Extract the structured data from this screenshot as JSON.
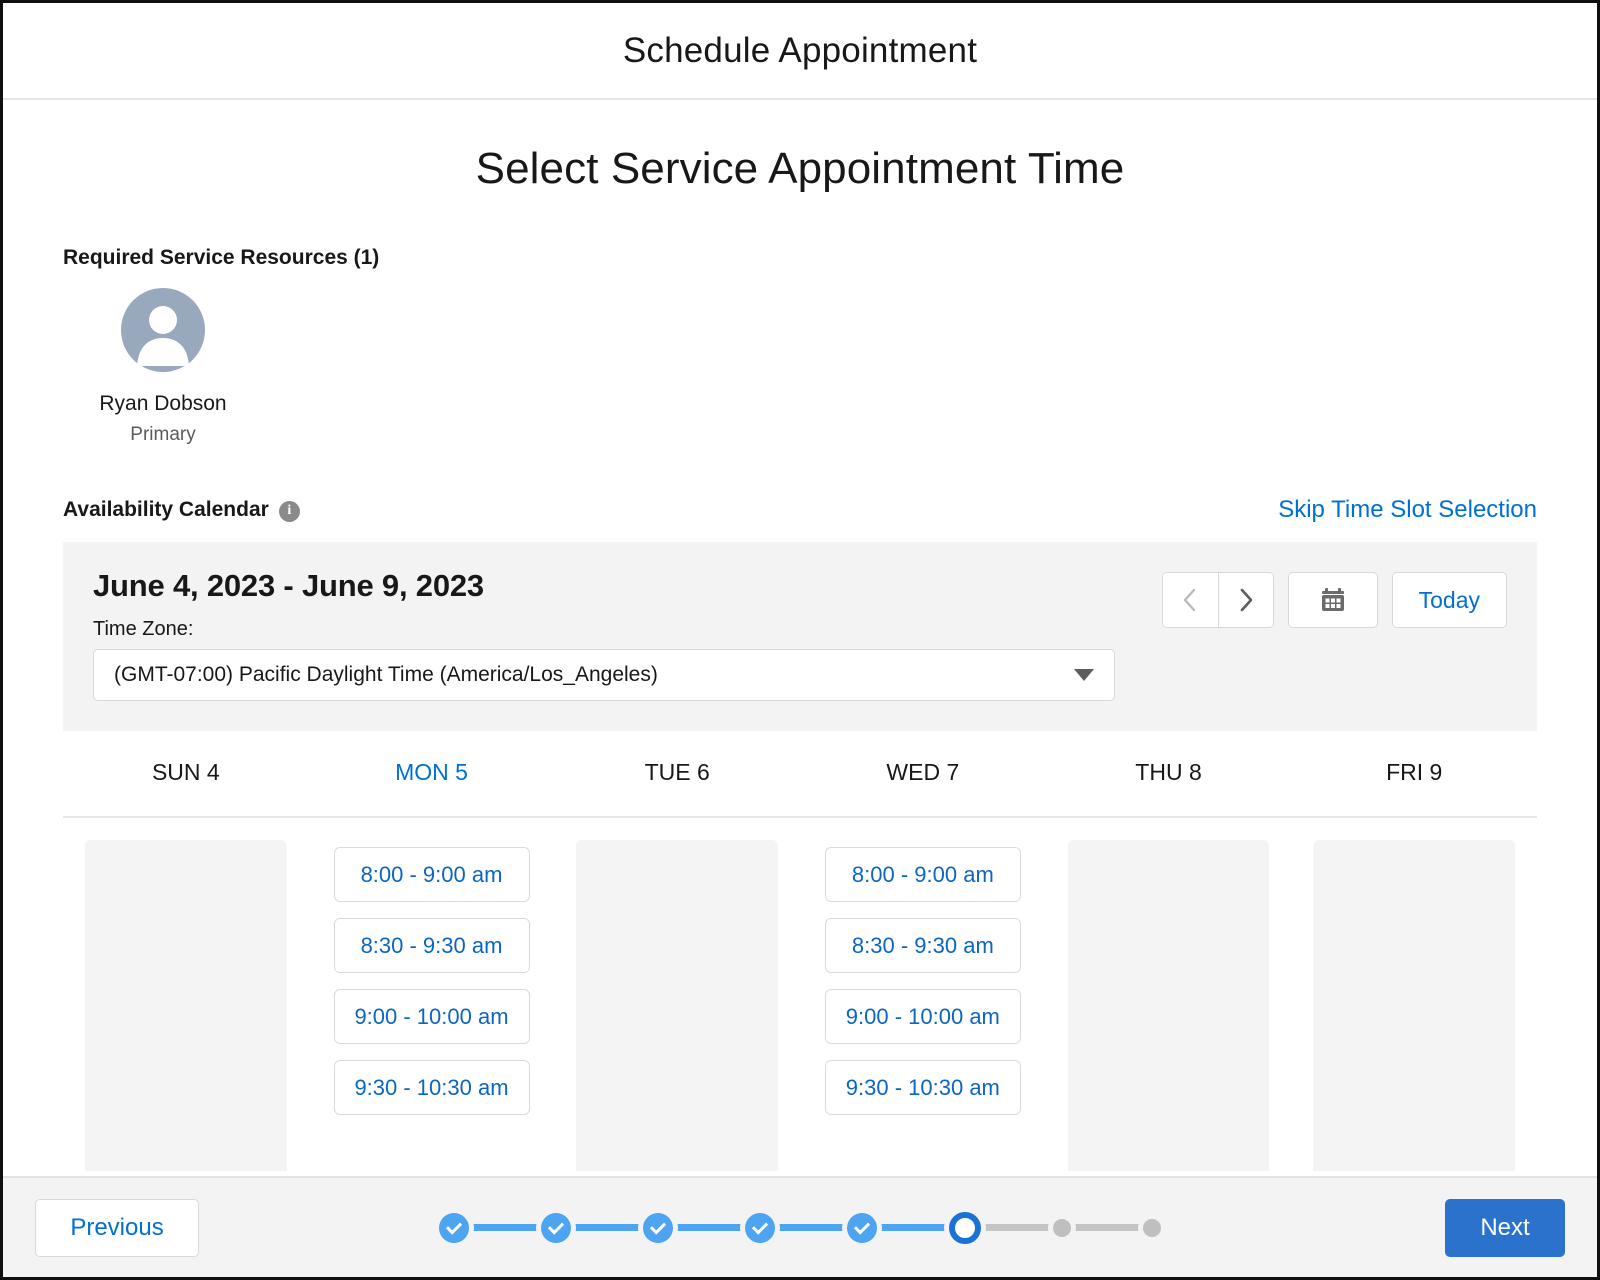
{
  "modal": {
    "title": "Schedule Appointment"
  },
  "page": {
    "heading": "Select Service Appointment Time"
  },
  "resources": {
    "section_label": "Required Service Resources (1)",
    "items": [
      {
        "name": "Ryan Dobson",
        "role": "Primary",
        "avatar_icon": "user-avatar-icon"
      }
    ]
  },
  "availability": {
    "label": "Availability Calendar",
    "info_icon": "info-icon",
    "info_glyph": "i",
    "skip_link": "Skip Time Slot Selection",
    "date_range": "June 4, 2023 - June 9, 2023",
    "timezone_label": "Time Zone:",
    "timezone_value": "(GMT-07:00) Pacific Daylight Time (America/Los_Angeles)",
    "prev_icon": "chevron-left-icon",
    "next_icon": "chevron-right-icon",
    "calendar_icon": "calendar-icon",
    "today_label": "Today",
    "days": [
      {
        "label": "SUN 4",
        "selected": false,
        "slots": []
      },
      {
        "label": "MON 5",
        "selected": true,
        "slots": [
          "8:00 - 9:00 am",
          "8:30 - 9:30 am",
          "9:00 - 10:00 am",
          "9:30 - 10:30 am"
        ]
      },
      {
        "label": "TUE 6",
        "selected": false,
        "slots": []
      },
      {
        "label": "WED 7",
        "selected": false,
        "slots": [
          "8:00 - 9:00 am",
          "8:30 - 9:30 am",
          "9:00 - 10:00 am",
          "9:30 - 10:30 am"
        ]
      },
      {
        "label": "THU 8",
        "selected": false,
        "slots": []
      },
      {
        "label": "FRI 9",
        "selected": false,
        "slots": []
      }
    ]
  },
  "footer": {
    "previous_label": "Previous",
    "next_label": "Next",
    "progress": {
      "steps": [
        "done",
        "done",
        "done",
        "done",
        "done",
        "current",
        "todo",
        "todo"
      ],
      "current_step": 6,
      "total_steps": 8
    }
  },
  "colors": {
    "link_blue": "#0070d2",
    "primary_blue": "#2b72cd",
    "progress_blue": "#4da4f0",
    "panel_gray": "#f3f3f3",
    "avatar_gray": "#98a9bd"
  }
}
